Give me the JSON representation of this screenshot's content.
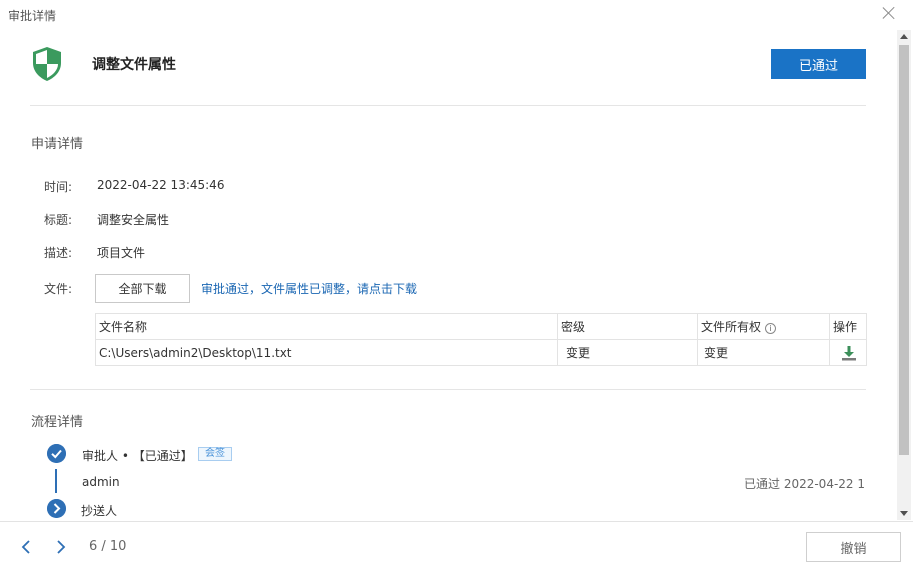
{
  "dialog": {
    "title": "审批详情"
  },
  "header": {
    "title": "调整文件属性",
    "status_button": "已通过"
  },
  "details": {
    "section_title": "申请详情",
    "fields": [
      {
        "label": "时间:",
        "value": "2022-04-22 13:45:46"
      },
      {
        "label": "标题:",
        "value": "调整安全属性"
      },
      {
        "label": "描述:",
        "value": "项目文件"
      },
      {
        "label": "文件:"
      }
    ],
    "download_button": "全部下载",
    "download_note": "审批通过，文件属性已调整，请点击下载"
  },
  "file_table": {
    "columns": [
      "文件名称",
      "密级",
      "文件所有权",
      "操作"
    ],
    "rows": [
      {
        "name": "C:\\Users\\admin2\\Desktop\\11.txt",
        "level": "变更",
        "ownership": "变更"
      }
    ]
  },
  "process": {
    "section_title": "流程详情",
    "steps": [
      {
        "title": "审批人 • 【已通过】",
        "tag": "会签",
        "person": "admin",
        "result": "已通过 2022-04-22 1"
      },
      {
        "title": "抄送人"
      }
    ]
  },
  "footer": {
    "pager": "6 / 10",
    "revoke_button": "撤销"
  },
  "colors": {
    "primary": "#1a73c6",
    "link": "#1b67b3",
    "step": "#2e6fb5",
    "shield": "#3b9a5e"
  }
}
